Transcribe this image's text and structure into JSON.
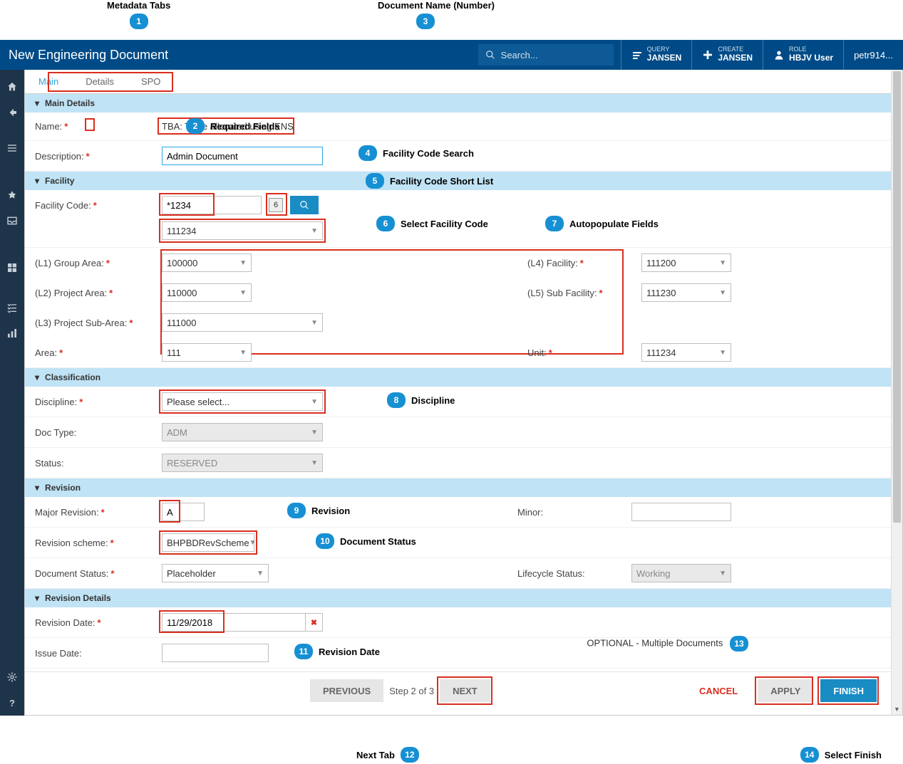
{
  "header": {
    "title": "New Engineering Document",
    "search_placeholder": "Search...",
    "query": {
      "small": "QUERY",
      "big": "JANSEN"
    },
    "create": {
      "small": "CREATE",
      "big": "JANSEN"
    },
    "role": {
      "small": "ROLE",
      "big": "HBJV User"
    },
    "user": "petr914..."
  },
  "tabs": {
    "main": "Main",
    "details": "Details",
    "spo": "SPO"
  },
  "sections": {
    "main_details": "Main Details",
    "facility": "Facility",
    "classification": "Classification",
    "revision": "Revision",
    "revision_details": "Revision Details"
  },
  "fields": {
    "name": {
      "label": "Name:",
      "value": "TBA: To be allocated using ENS"
    },
    "description": {
      "label": "Description:",
      "value": "Admin Document"
    },
    "facility_code": {
      "label": "Facility Code:",
      "search": "*1234",
      "count": "6",
      "selected": "111234"
    },
    "l1": {
      "label": "(L1) Group Area:",
      "value": "100000"
    },
    "l2": {
      "label": "(L2) Project Area:",
      "value": "110000"
    },
    "l3": {
      "label": "(L3) Project Sub-Area:",
      "value": "111000"
    },
    "l4": {
      "label": "(L4) Facility:",
      "value": "111200"
    },
    "l5": {
      "label": "(L5) Sub Facility:",
      "value": "111230"
    },
    "area": {
      "label": "Area:",
      "value": "111"
    },
    "unit": {
      "label": "Unit:",
      "value": "111234"
    },
    "discipline": {
      "label": "Discipline:",
      "value": "Please select..."
    },
    "doc_type": {
      "label": "Doc Type:",
      "value": "ADM"
    },
    "status": {
      "label": "Status:",
      "value": "RESERVED"
    },
    "major_rev": {
      "label": "Major Revision:",
      "value": "A"
    },
    "minor": {
      "label": "Minor:",
      "value": ""
    },
    "rev_scheme": {
      "label": "Revision scheme:",
      "value": "BHPBDRevScheme"
    },
    "doc_status": {
      "label": "Document Status:",
      "value": "Placeholder"
    },
    "lifecycle": {
      "label": "Lifecycle Status:",
      "value": "Working"
    },
    "rev_date": {
      "label": "Revision Date:",
      "value": "11/29/2018"
    },
    "issue_date": {
      "label": "Issue Date:",
      "value": ""
    }
  },
  "footer": {
    "previous": "PREVIOUS",
    "step": "Step 2 of 3",
    "next": "NEXT",
    "cancel": "CANCEL",
    "apply": "APPLY",
    "finish": "FINISH",
    "optional_text": "OPTIONAL - Multiple Documents"
  },
  "callouts": {
    "c1": {
      "n": "1",
      "text": "Metadata Tabs"
    },
    "c2": {
      "n": "2",
      "text": "Required Fields"
    },
    "c3": {
      "n": "3",
      "text": "Document Name (Number)"
    },
    "c4": {
      "n": "4",
      "text": "Facility Code Search"
    },
    "c5": {
      "n": "5",
      "text": "Facility Code Short List"
    },
    "c6": {
      "n": "6",
      "text": "Select Facility Code"
    },
    "c7": {
      "n": "7",
      "text": "Autopopulate Fields"
    },
    "c8": {
      "n": "8",
      "text": "Discipline"
    },
    "c9": {
      "n": "9",
      "text": "Revision"
    },
    "c10": {
      "n": "10",
      "text": "Document Status"
    },
    "c11": {
      "n": "11",
      "text": "Revision Date"
    },
    "c12": {
      "n": "12",
      "text": "Next Tab"
    },
    "c13": {
      "n": "13",
      "text": ""
    },
    "c14": {
      "n": "14",
      "text": "Select Finish"
    }
  }
}
